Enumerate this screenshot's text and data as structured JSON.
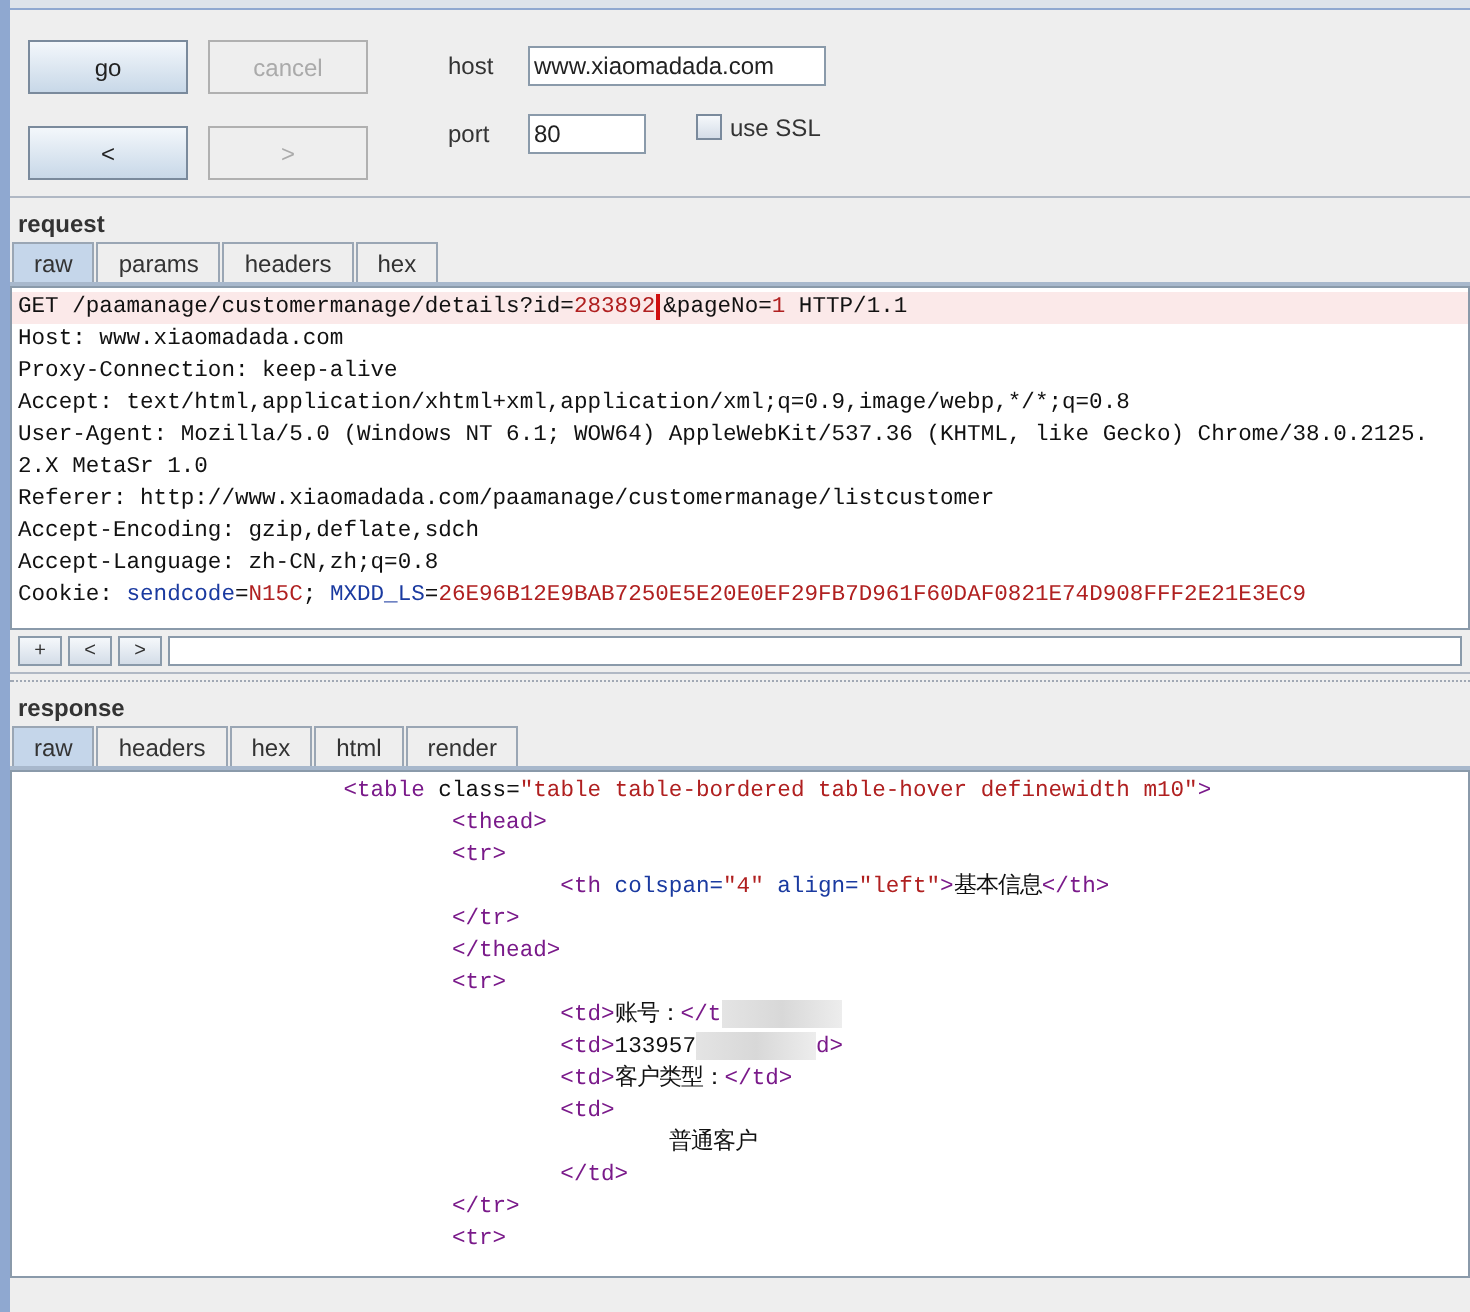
{
  "buttons": [
    {
      "label": "go",
      "disabled": false
    },
    {
      "label": "cancel",
      "disabled": true
    },
    {
      "label": "<",
      "disabled": false
    },
    {
      "label": ">",
      "disabled": true
    }
  ],
  "host": {
    "label": "host",
    "value": "www.xiaomadada.com"
  },
  "port": {
    "label": "port",
    "value": "80"
  },
  "use_ssl": {
    "label": "use SSL",
    "checked": false
  },
  "request": {
    "title": "request",
    "tabs": [
      {
        "label": "raw",
        "selected": true
      },
      {
        "label": "params",
        "selected": false
      },
      {
        "label": "headers",
        "selected": false
      },
      {
        "label": "hex",
        "selected": false
      }
    ],
    "lines": [
      {
        "current": true,
        "segments": [
          {
            "kind": "plain",
            "text": "GET /paamanage/customermanage/details?id="
          },
          {
            "kind": "value",
            "text": "283892"
          },
          {
            "kind": "caret"
          },
          {
            "kind": "plain",
            "text": "&pageNo="
          },
          {
            "kind": "value",
            "text": "1"
          },
          {
            "kind": "plain",
            "text": " HTTP/1.1"
          }
        ]
      },
      {
        "current": false,
        "segments": [
          {
            "kind": "plain",
            "text": "Host: www.xiaomadada.com"
          }
        ]
      },
      {
        "current": false,
        "segments": [
          {
            "kind": "plain",
            "text": "Proxy-Connection: keep-alive"
          }
        ]
      },
      {
        "current": false,
        "segments": [
          {
            "kind": "plain",
            "text": "Accept: text/html,application/xhtml+xml,application/xml;q=0.9,image/webp,*/*;q=0.8"
          }
        ]
      },
      {
        "current": false,
        "segments": [
          {
            "kind": "plain",
            "text": "User-Agent: Mozilla/5.0 (Windows NT 6.1; WOW64) AppleWebKit/537.36 (KHTML, like Gecko) Chrome/38.0.2125."
          }
        ]
      },
      {
        "current": false,
        "segments": [
          {
            "kind": "plain",
            "text": "2.X MetaSr 1.0"
          }
        ]
      },
      {
        "current": false,
        "segments": [
          {
            "kind": "plain",
            "text": "Referer: http://www.xiaomadada.com/paamanage/customermanage/listcustomer"
          }
        ]
      },
      {
        "current": false,
        "segments": [
          {
            "kind": "plain",
            "text": "Accept-Encoding: gzip,deflate,sdch"
          }
        ]
      },
      {
        "current": false,
        "segments": [
          {
            "kind": "plain",
            "text": "Accept-Language: zh-CN,zh;q=0.8"
          }
        ]
      },
      {
        "current": false,
        "segments": [
          {
            "kind": "plain",
            "text": "Cookie: "
          },
          {
            "kind": "name",
            "text": "sendcode"
          },
          {
            "kind": "plain",
            "text": "="
          },
          {
            "kind": "value",
            "text": "N15C"
          },
          {
            "kind": "plain",
            "text": "; "
          },
          {
            "kind": "name",
            "text": "MXDD_LS"
          },
          {
            "kind": "plain",
            "text": "="
          },
          {
            "kind": "value",
            "text": "26E96B12E9BAB7250E5E20E0EF29FB7D961F60DAF0821E74D908FFF2E21E3EC9"
          }
        ]
      }
    ],
    "nav_buttons": [
      "+",
      "<",
      ">"
    ]
  },
  "response": {
    "title": "response",
    "tabs": [
      {
        "label": "raw",
        "selected": true
      },
      {
        "label": "headers",
        "selected": false
      },
      {
        "label": "hex",
        "selected": false
      },
      {
        "label": "html",
        "selected": false
      },
      {
        "label": "render",
        "selected": false
      }
    ],
    "lines": [
      {
        "segments": [
          {
            "kind": "tag",
            "text": "\t\t\t<table"
          },
          {
            "kind": "plain",
            "text": " class="
          },
          {
            "kind": "value",
            "text": "\"table table-bordered table-hover definewidth m10\""
          },
          {
            "kind": "tag",
            "text": ">"
          }
        ]
      },
      {
        "segments": [
          {
            "kind": "tag",
            "text": "\t\t\t\t<thead>"
          }
        ]
      },
      {
        "segments": [
          {
            "kind": "tag",
            "text": "\t\t\t\t<tr>"
          }
        ]
      },
      {
        "segments": [
          {
            "kind": "tag",
            "text": "\t\t\t\t\t<th"
          },
          {
            "kind": "name",
            "text": " colspan="
          },
          {
            "kind": "value",
            "text": "\"4\""
          },
          {
            "kind": "name",
            "text": " align="
          },
          {
            "kind": "value",
            "text": "\"left\""
          },
          {
            "kind": "tag",
            "text": ">"
          },
          {
            "kind": "plain",
            "text": "基本信息"
          },
          {
            "kind": "tag",
            "text": "</th>"
          }
        ]
      },
      {
        "segments": [
          {
            "kind": "tag",
            "text": "\t\t\t\t</tr>"
          }
        ]
      },
      {
        "segments": [
          {
            "kind": "tag",
            "text": "\t\t\t\t</thead>"
          }
        ]
      },
      {
        "segments": [
          {
            "kind": "tag",
            "text": "\t\t\t\t<tr>"
          }
        ]
      },
      {
        "segments": [
          {
            "kind": "tag",
            "text": "\t\t\t\t\t<td>"
          },
          {
            "kind": "plain",
            "text": "账号："
          },
          {
            "kind": "tag",
            "text": "</t"
          },
          {
            "kind": "redacted"
          }
        ]
      },
      {
        "segments": [
          {
            "kind": "tag",
            "text": "\t\t\t\t\t<td>"
          },
          {
            "kind": "plain",
            "text": "133957"
          },
          {
            "kind": "redacted"
          },
          {
            "kind": "tag",
            "text": "d>"
          }
        ]
      },
      {
        "segments": [
          {
            "kind": "tag",
            "text": "\t\t\t\t\t<td>"
          },
          {
            "kind": "plain",
            "text": "客户类型："
          },
          {
            "kind": "tag",
            "text": "</td>"
          }
        ]
      },
      {
        "segments": [
          {
            "kind": "tag",
            "text": "\t\t\t\t\t<td>"
          }
        ]
      },
      {
        "segments": [
          {
            "kind": "plain",
            "text": "\t\t\t\t\t\t普通客户"
          }
        ]
      },
      {
        "segments": [
          {
            "kind": "tag",
            "text": "\t\t\t\t\t</td>"
          }
        ]
      },
      {
        "segments": [
          {
            "kind": "tag",
            "text": "\t\t\t\t</tr>"
          }
        ]
      },
      {
        "segments": [
          {
            "kind": "tag",
            "text": "\t\t\t\t<tr>"
          }
        ]
      }
    ]
  }
}
